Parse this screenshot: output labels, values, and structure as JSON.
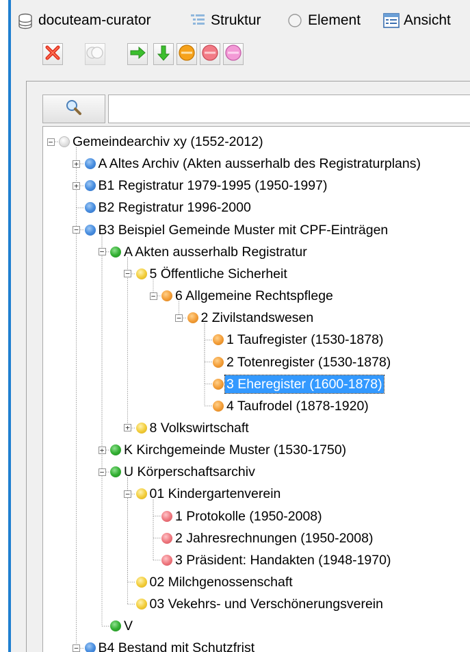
{
  "menubar": {
    "items": [
      {
        "label": "docuteam-curator",
        "icon": "database-icon"
      },
      {
        "label": "Struktur",
        "icon": "tree-structure-icon"
      },
      {
        "label": "Element",
        "icon": "element-circle-icon"
      },
      {
        "label": "Ansicht",
        "icon": "view-window-icon"
      }
    ]
  },
  "toolbar": {
    "buttons": [
      {
        "name": "delete-button",
        "icon": "red-x-icon"
      },
      {
        "name": "toggle-button",
        "icon": "double-circle-icon"
      },
      {
        "name": "move-right-button",
        "icon": "green-arrow-right-icon"
      },
      {
        "name": "move-down-button",
        "icon": "green-arrow-down-icon"
      },
      {
        "name": "set-orange-level-button",
        "icon": "orange-circle-icon"
      },
      {
        "name": "set-red-level-button",
        "icon": "red-circle-icon"
      },
      {
        "name": "set-pink-level-button",
        "icon": "pink-circle-icon"
      }
    ]
  },
  "search": {
    "value": "",
    "icon": "magnifier-icon"
  },
  "colors": {
    "selection": "#3399ff",
    "grey": "#d6d6d6",
    "blue": "#4a8fe0",
    "green": "#34b034",
    "yellow": "#f3cf3f",
    "orange": "#f4a03c",
    "red": "#ef7b82"
  },
  "tree": [
    {
      "label": "Gemeindearchiv xy (1552-2012)",
      "level": 0,
      "color": "grey",
      "expander": "−",
      "selected": false
    },
    {
      "label": "A Altes Archiv (Akten ausserhalb des Registraturplans)",
      "level": 1,
      "color": "blue",
      "expander": "+",
      "selected": false
    },
    {
      "label": "B1 Registratur 1979-1995 (1950-1997)",
      "level": 1,
      "color": "blue",
      "expander": "+",
      "selected": false
    },
    {
      "label": "B2 Registratur 1996-2000",
      "level": 1,
      "color": "blue",
      "expander": "",
      "selected": false
    },
    {
      "label": "B3 Beispiel Gemeinde Muster mit CPF-Einträgen",
      "level": 1,
      "color": "blue",
      "expander": "−",
      "selected": false
    },
    {
      "label": "A Akten ausserhalb Registratur",
      "level": 2,
      "color": "green",
      "expander": "−",
      "selected": false
    },
    {
      "label": "5 Öffentliche Sicherheit",
      "level": 3,
      "color": "yellow",
      "expander": "−",
      "selected": false
    },
    {
      "label": "6 Allgemeine Rechtspflege",
      "level": 4,
      "color": "orange",
      "expander": "−",
      "selected": false
    },
    {
      "label": "2 Zivilstandswesen",
      "level": 5,
      "color": "orange",
      "expander": "−",
      "selected": false
    },
    {
      "label": "1 Taufregister (1530-1878)",
      "level": 6,
      "color": "orange",
      "expander": "",
      "selected": false
    },
    {
      "label": "2 Totenregister (1530-1878)",
      "level": 6,
      "color": "orange",
      "expander": "",
      "selected": false
    },
    {
      "label": "3 Eheregister (1600-1878)",
      "level": 6,
      "color": "orange",
      "expander": "",
      "selected": true
    },
    {
      "label": "4 Taufrodel (1878-1920)",
      "level": 6,
      "color": "orange",
      "expander": "",
      "selected": false
    },
    {
      "label": "8 Volkswirtschaft",
      "level": 3,
      "color": "yellow",
      "expander": "+",
      "selected": false
    },
    {
      "label": "K Kirchgemeinde Muster (1530-1750)",
      "level": 2,
      "color": "green",
      "expander": "+",
      "selected": false
    },
    {
      "label": "U Körperschaftsarchiv",
      "level": 2,
      "color": "green",
      "expander": "−",
      "selected": false
    },
    {
      "label": "01 Kindergartenverein",
      "level": 3,
      "color": "yellow",
      "expander": "−",
      "selected": false
    },
    {
      "label": "1 Protokolle (1950-2008)",
      "level": 4,
      "color": "red",
      "expander": "",
      "selected": false
    },
    {
      "label": "2 Jahresrechnungen (1950-2008)",
      "level": 4,
      "color": "red",
      "expander": "",
      "selected": false
    },
    {
      "label": "3 Präsident: Handakten (1948-1970)",
      "level": 4,
      "color": "red",
      "expander": "",
      "selected": false
    },
    {
      "label": "02 Milchgenossenschaft",
      "level": 3,
      "color": "yellow",
      "expander": "",
      "selected": false
    },
    {
      "label": "03 Vekehrs- und Verschönerungsverein",
      "level": 3,
      "color": "yellow",
      "expander": "",
      "selected": false
    },
    {
      "label": "V",
      "level": 2,
      "color": "green",
      "expander": "",
      "selected": false
    },
    {
      "label": "B4 Bestand mit Schutzfrist",
      "level": 1,
      "color": "blue",
      "expander": "−",
      "selected": false
    }
  ]
}
